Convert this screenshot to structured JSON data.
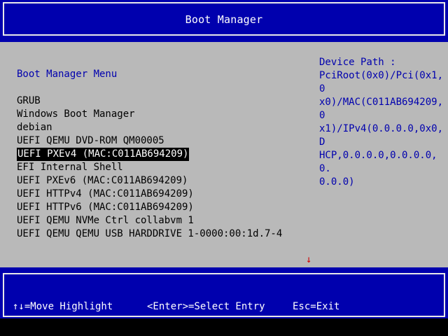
{
  "header": {
    "title": "Boot Manager"
  },
  "menu": {
    "title": "Boot Manager Menu",
    "entries": [
      "GRUB",
      "Windows Boot Manager",
      "debian",
      "UEFI QEMU DVD-ROM QM00005",
      "UEFI PXEv4 (MAC:C011AB694209)",
      "EFI Internal Shell",
      "UEFI PXEv6 (MAC:C011AB694209)",
      "UEFI HTTPv4 (MAC:C011AB694209)",
      "UEFI HTTPv6 (MAC:C011AB694209)",
      "UEFI QEMU NVMe Ctrl collabvm 1",
      "UEFI QEMU QEMU USB HARDDRIVE 1-0000:00:1d.7-4"
    ],
    "selected_index": 4
  },
  "help": {
    "label": "Device Path :",
    "lines": [
      "PciRoot(0x0)/Pci(0x1,0",
      "x0)/MAC(C011AB694209,0",
      "x1)/IPv4(0.0.0.0,0x0,D",
      "HCP,0.0.0.0,0.0.0.0,0.",
      "0.0.0)"
    ]
  },
  "scroll_indicator": "↓",
  "footer": {
    "move": "↑↓=Move Highlight",
    "select": "<Enter>=Select Entry",
    "exit": "Esc=Exit"
  },
  "colors": {
    "blue": "#0000ae",
    "gray": "#b9b9b9",
    "white": "#ffffff",
    "black": "#000000",
    "red": "#d00000"
  }
}
